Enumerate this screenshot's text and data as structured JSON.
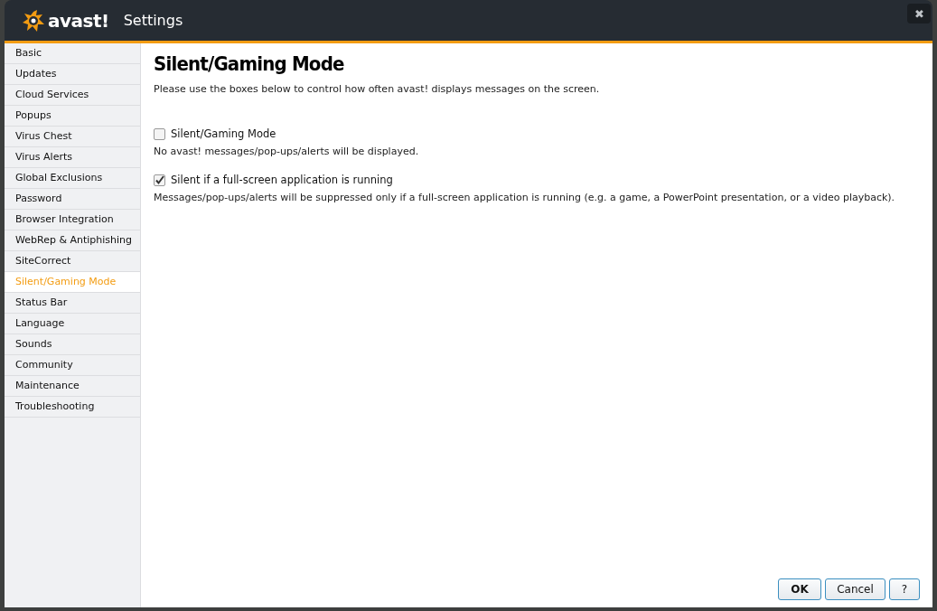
{
  "window": {
    "logo": "avast!",
    "title": "Settings",
    "close": "✖"
  },
  "sidebar": {
    "items": [
      {
        "label": "Basic",
        "selected": false
      },
      {
        "label": "Updates",
        "selected": false
      },
      {
        "label": "Cloud Services",
        "selected": false
      },
      {
        "label": "Popups",
        "selected": false
      },
      {
        "label": "Virus Chest",
        "selected": false
      },
      {
        "label": "Virus Alerts",
        "selected": false
      },
      {
        "label": "Global Exclusions",
        "selected": false
      },
      {
        "label": "Password",
        "selected": false
      },
      {
        "label": "Browser Integration",
        "selected": false
      },
      {
        "label": "WebRep & Antiphishing",
        "selected": false
      },
      {
        "label": "SiteCorrect",
        "selected": false
      },
      {
        "label": "Silent/Gaming Mode",
        "selected": true
      },
      {
        "label": "Status Bar",
        "selected": false
      },
      {
        "label": "Language",
        "selected": false
      },
      {
        "label": "Sounds",
        "selected": false
      },
      {
        "label": "Community",
        "selected": false
      },
      {
        "label": "Maintenance",
        "selected": false
      },
      {
        "label": "Troubleshooting",
        "selected": false
      }
    ]
  },
  "content": {
    "heading": "Silent/Gaming Mode",
    "intro": "Please use the boxes below to control how often avast! displays messages on the screen.",
    "options": [
      {
        "label": "Silent/Gaming Mode",
        "checked": false,
        "description": "No avast! messages/pop-ups/alerts will be displayed."
      },
      {
        "label": "Silent if a full-screen application is running",
        "checked": true,
        "description": "Messages/pop-ups/alerts will be suppressed only if a full-screen application is running (e.g. a game, a PowerPoint presentation, or a video playback)."
      }
    ]
  },
  "buttons": [
    {
      "label": "OK",
      "kind": "primary"
    },
    {
      "label": "Cancel",
      "kind": "normal"
    },
    {
      "label": "?",
      "kind": "help"
    }
  ]
}
